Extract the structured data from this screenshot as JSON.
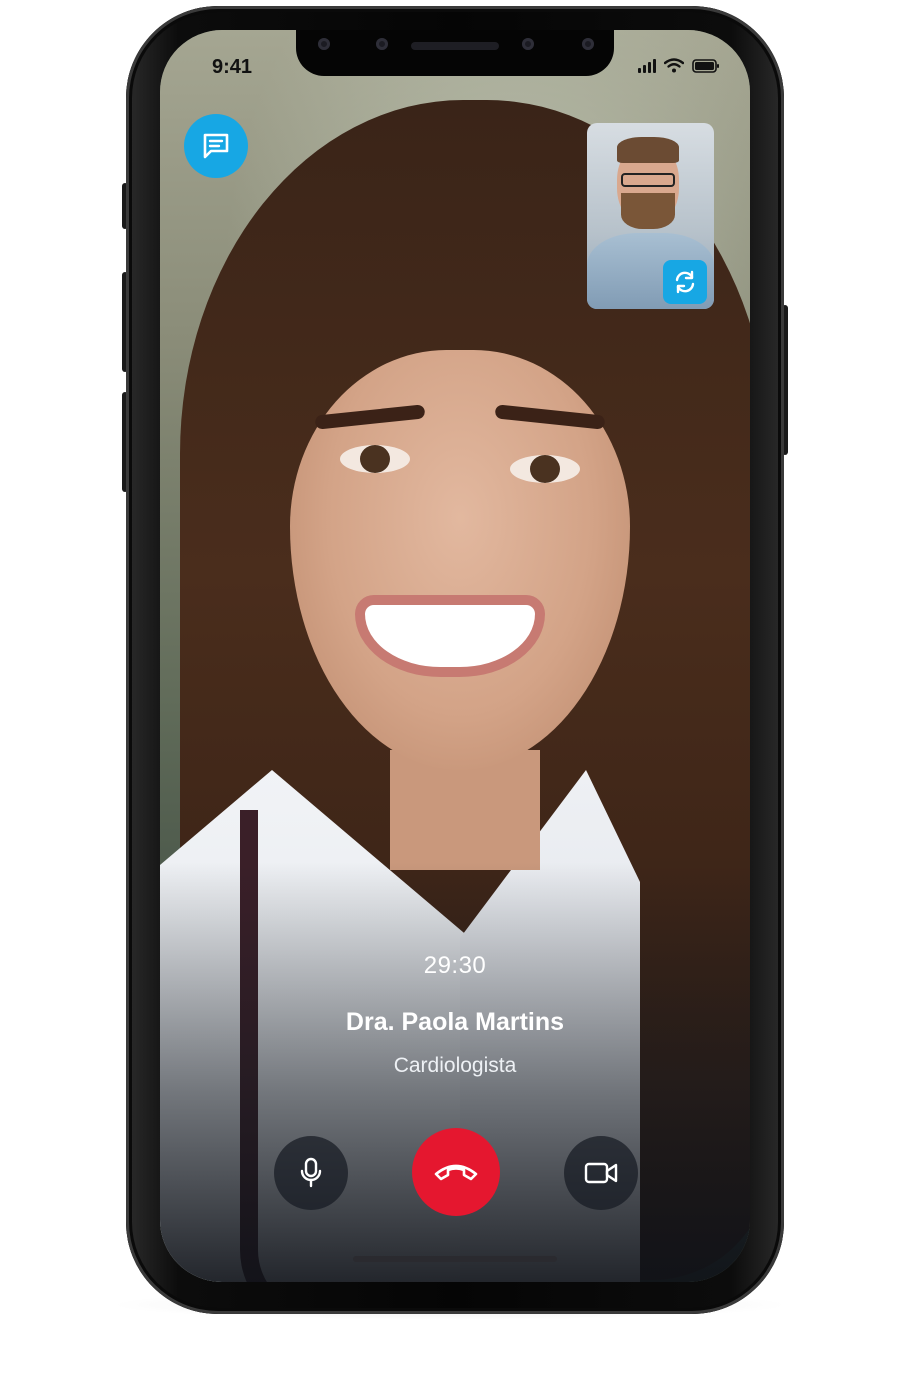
{
  "status_bar": {
    "time": "9:41",
    "icons": [
      "signal-icon",
      "wifi-icon",
      "battery-icon"
    ]
  },
  "chat": {
    "icon": "chat-icon",
    "accent": "#17A7E4"
  },
  "self_view": {
    "switch_icon": "switch-camera-icon"
  },
  "call": {
    "duration": "29:30",
    "caller_name": "Dra. Paola Martins",
    "caller_role": "Cardiologista"
  },
  "controls": {
    "mute_icon": "microphone-icon",
    "end_icon": "end-call-icon",
    "video_icon": "video-camera-icon",
    "end_color": "#E5172F"
  }
}
